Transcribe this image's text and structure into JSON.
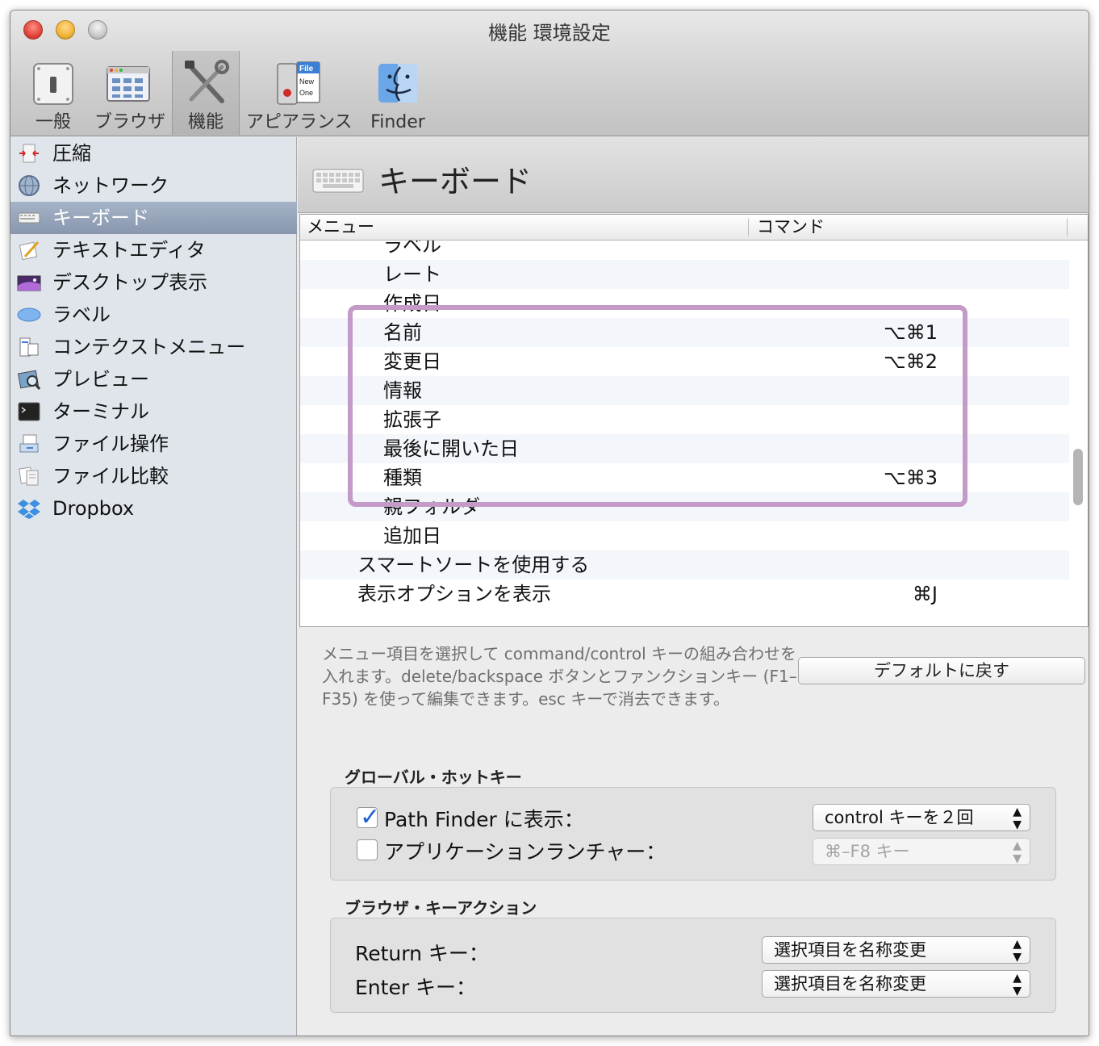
{
  "window": {
    "title": "機能 環境設定"
  },
  "toolbar": {
    "items": [
      {
        "label": "一般",
        "icon": "switch-icon"
      },
      {
        "label": "ブラウザ",
        "icon": "browser-window-icon"
      },
      {
        "label": "機能",
        "icon": "tools-icon",
        "selected": true
      },
      {
        "label": "アピアランス",
        "icon": "appearance-icon",
        "badge_lines": [
          "File",
          "New",
          "One"
        ]
      },
      {
        "label": "Finder",
        "icon": "finder-icon"
      }
    ]
  },
  "sidebar": {
    "items": [
      {
        "label": "圧縮",
        "icon": "compress-icon"
      },
      {
        "label": "ネットワーク",
        "icon": "network-globe-icon"
      },
      {
        "label": "キーボード",
        "icon": "keyboard-icon",
        "selected": true
      },
      {
        "label": "テキストエディタ",
        "icon": "text-editor-icon"
      },
      {
        "label": "デスクトップ表示",
        "icon": "desktop-icon"
      },
      {
        "label": "ラベル",
        "icon": "label-icon"
      },
      {
        "label": "コンテクストメニュー",
        "icon": "context-menu-icon"
      },
      {
        "label": "プレビュー",
        "icon": "preview-icon"
      },
      {
        "label": "ターミナル",
        "icon": "terminal-icon"
      },
      {
        "label": "ファイル操作",
        "icon": "file-operation-icon"
      },
      {
        "label": "ファイル比較",
        "icon": "file-compare-icon"
      },
      {
        "label": "Dropbox",
        "icon": "dropbox-icon"
      }
    ]
  },
  "panel": {
    "title": "キーボード",
    "table": {
      "col_menu": "メニュー",
      "col_command": "コマンド",
      "rows": [
        {
          "name": "ラベル",
          "key": "",
          "indent": 2
        },
        {
          "name": "レート",
          "key": "",
          "indent": 2
        },
        {
          "name": "作成日",
          "key": "",
          "indent": 2
        },
        {
          "name": "名前",
          "key": "⌥⌘1",
          "indent": 2
        },
        {
          "name": "変更日",
          "key": "⌥⌘2",
          "indent": 2
        },
        {
          "name": "情報",
          "key": "",
          "indent": 2
        },
        {
          "name": "拡張子",
          "key": "",
          "indent": 2
        },
        {
          "name": "最後に開いた日",
          "key": "",
          "indent": 2
        },
        {
          "name": "種類",
          "key": "⌥⌘3",
          "indent": 2
        },
        {
          "name": "親フォルダ",
          "key": "",
          "indent": 2
        },
        {
          "name": "追加日",
          "key": "",
          "indent": 2
        },
        {
          "name": "スマートソートを使用する",
          "key": "",
          "indent": 1
        },
        {
          "name": "表示オプションを表示",
          "key": "⌘J",
          "indent": 1
        }
      ]
    },
    "help_text": "メニュー項目を選択して command/control キーの組み合わせを入れます。delete/backspace ボタンとファンクションキー (F1–F35) を使って編集できます。esc キーで消去できます。",
    "default_button": "デフォルトに戻す",
    "global_hotkey": {
      "title": "グローバル・ホットキー",
      "path_finder_label": "Path Finder に表示：",
      "path_finder_checked": true,
      "path_finder_value": "control キーを２回",
      "launcher_label": "アプリケーションランチャー：",
      "launcher_checked": false,
      "launcher_value": "⌘–F8 キー"
    },
    "browser_key_action": {
      "title": "ブラウザ・キーアクション",
      "return_label": "Return キー：",
      "return_value": "選択項目を名称変更",
      "enter_label": "Enter キー：",
      "enter_value": "選択項目を名称変更"
    },
    "highlight_color": "#c49ac8"
  }
}
